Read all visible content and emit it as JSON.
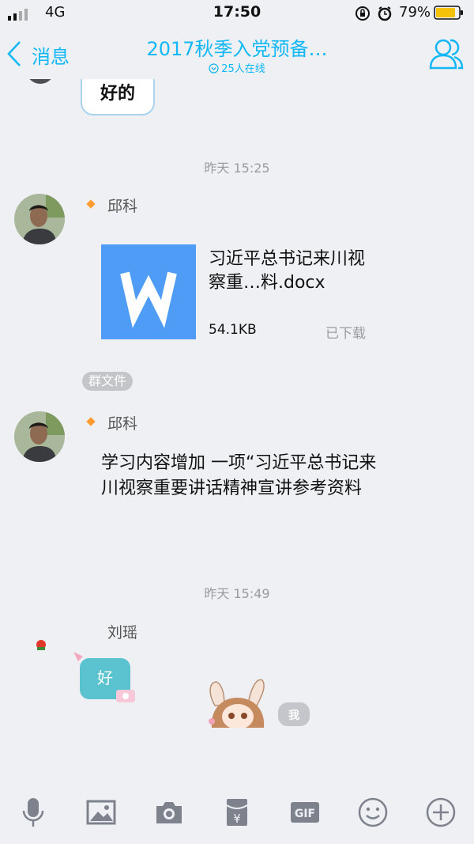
{
  "status_bar": {
    "network": "4G",
    "time": "17:50",
    "battery": "79%"
  },
  "nav": {
    "back_label": "消息",
    "title": "2017秋季入党预备…",
    "subtitle": "25人在线"
  },
  "messages": {
    "prev_bubble": "好的",
    "timestamp1": "昨天 15:25",
    "sender1": "邱科",
    "file": {
      "name": "习近平总书记来川视察重…料.docx",
      "size": "54.1KB",
      "status": "已下载",
      "tag": "群文件"
    },
    "sender2": "邱科",
    "text2": "学习内容增加 一项“习近平总书记来川视察重要讲话精神宣讲参考资料",
    "timestamp2": "昨天 15:49",
    "sender3": "刘瑶",
    "sticker1_text": "好",
    "sticker2_text": "我"
  },
  "toolbar": {
    "icons": [
      "microphone-icon",
      "image-icon",
      "camera-icon",
      "red-packet-icon",
      "gif-icon",
      "emoji-icon",
      "plus-icon"
    ],
    "gif_label": "GIF"
  },
  "colors": {
    "accent": "#12b7f5",
    "background": "#eef0f4",
    "file_blue": "#4f9cf6",
    "muted": "#9a9ba0"
  }
}
